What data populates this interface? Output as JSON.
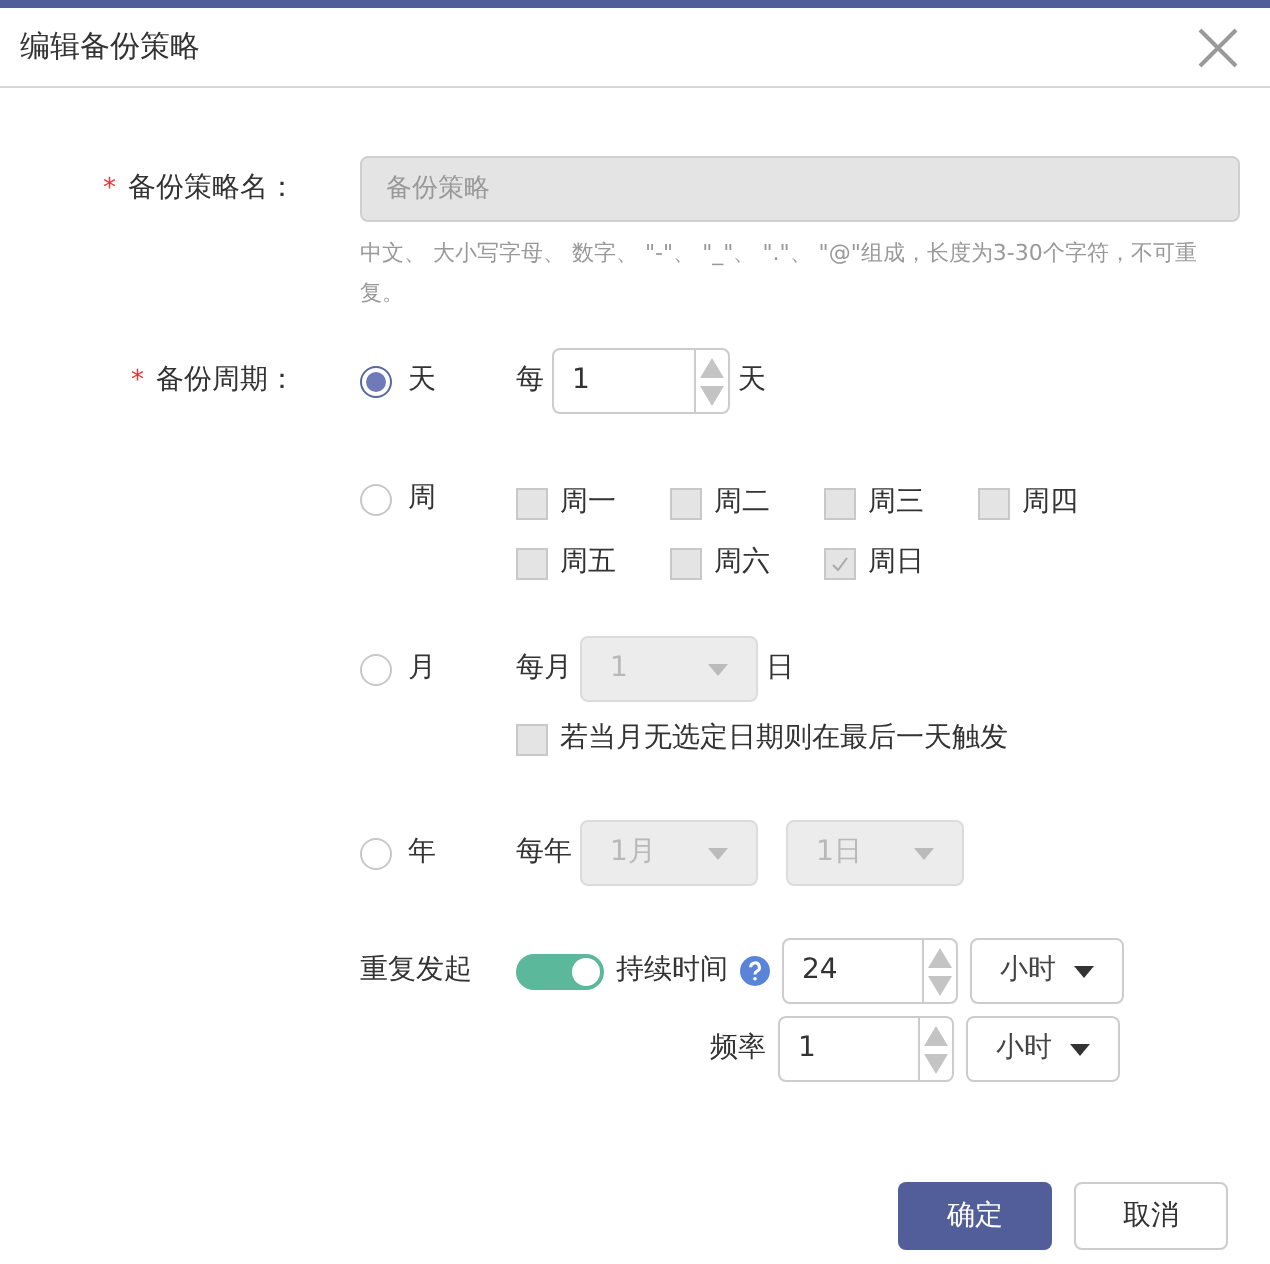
{
  "dialog": {
    "title": "编辑备份策略"
  },
  "name_field": {
    "label": "备份策略名：",
    "required_mark": "*",
    "placeholder": "备份策略",
    "hint": "中文、 大小写字母、 数字、 \"-\"、 \"_\"、 \".\"、 \"@\"组成，长度为3-30个字符，不可重复。"
  },
  "period": {
    "label": "备份周期：",
    "required_mark": "*",
    "options": [
      {
        "kind": "day",
        "label": "天",
        "selected": true,
        "prefix": "每",
        "value": "1",
        "suffix": "天"
      },
      {
        "kind": "week",
        "label": "周",
        "selected": false,
        "days": [
          {
            "label": "周一",
            "checked": false
          },
          {
            "label": "周二",
            "checked": false
          },
          {
            "label": "周三",
            "checked": false
          },
          {
            "label": "周四",
            "checked": false
          },
          {
            "label": "周五",
            "checked": false
          },
          {
            "label": "周六",
            "checked": false
          },
          {
            "label": "周日",
            "checked": true
          }
        ]
      },
      {
        "kind": "month",
        "label": "月",
        "selected": false,
        "prefix": "每月",
        "value": "1",
        "suffix": "日",
        "fallback": {
          "label": "若当月无选定日期则在最后一天触发",
          "checked": false
        }
      },
      {
        "kind": "year",
        "label": "年",
        "selected": false,
        "prefix": "每年",
        "month": "1月",
        "day": "1日"
      }
    ]
  },
  "repeat": {
    "label": "重复发起",
    "on": true,
    "duration": {
      "label": "持续时间",
      "value": "24",
      "unit": "小时"
    },
    "frequency": {
      "label": "频率",
      "value": "1",
      "unit": "小时"
    }
  },
  "buttons": [
    {
      "kind": "primary",
      "label": "确定"
    },
    {
      "kind": "secondary",
      "label": "取消"
    }
  ]
}
